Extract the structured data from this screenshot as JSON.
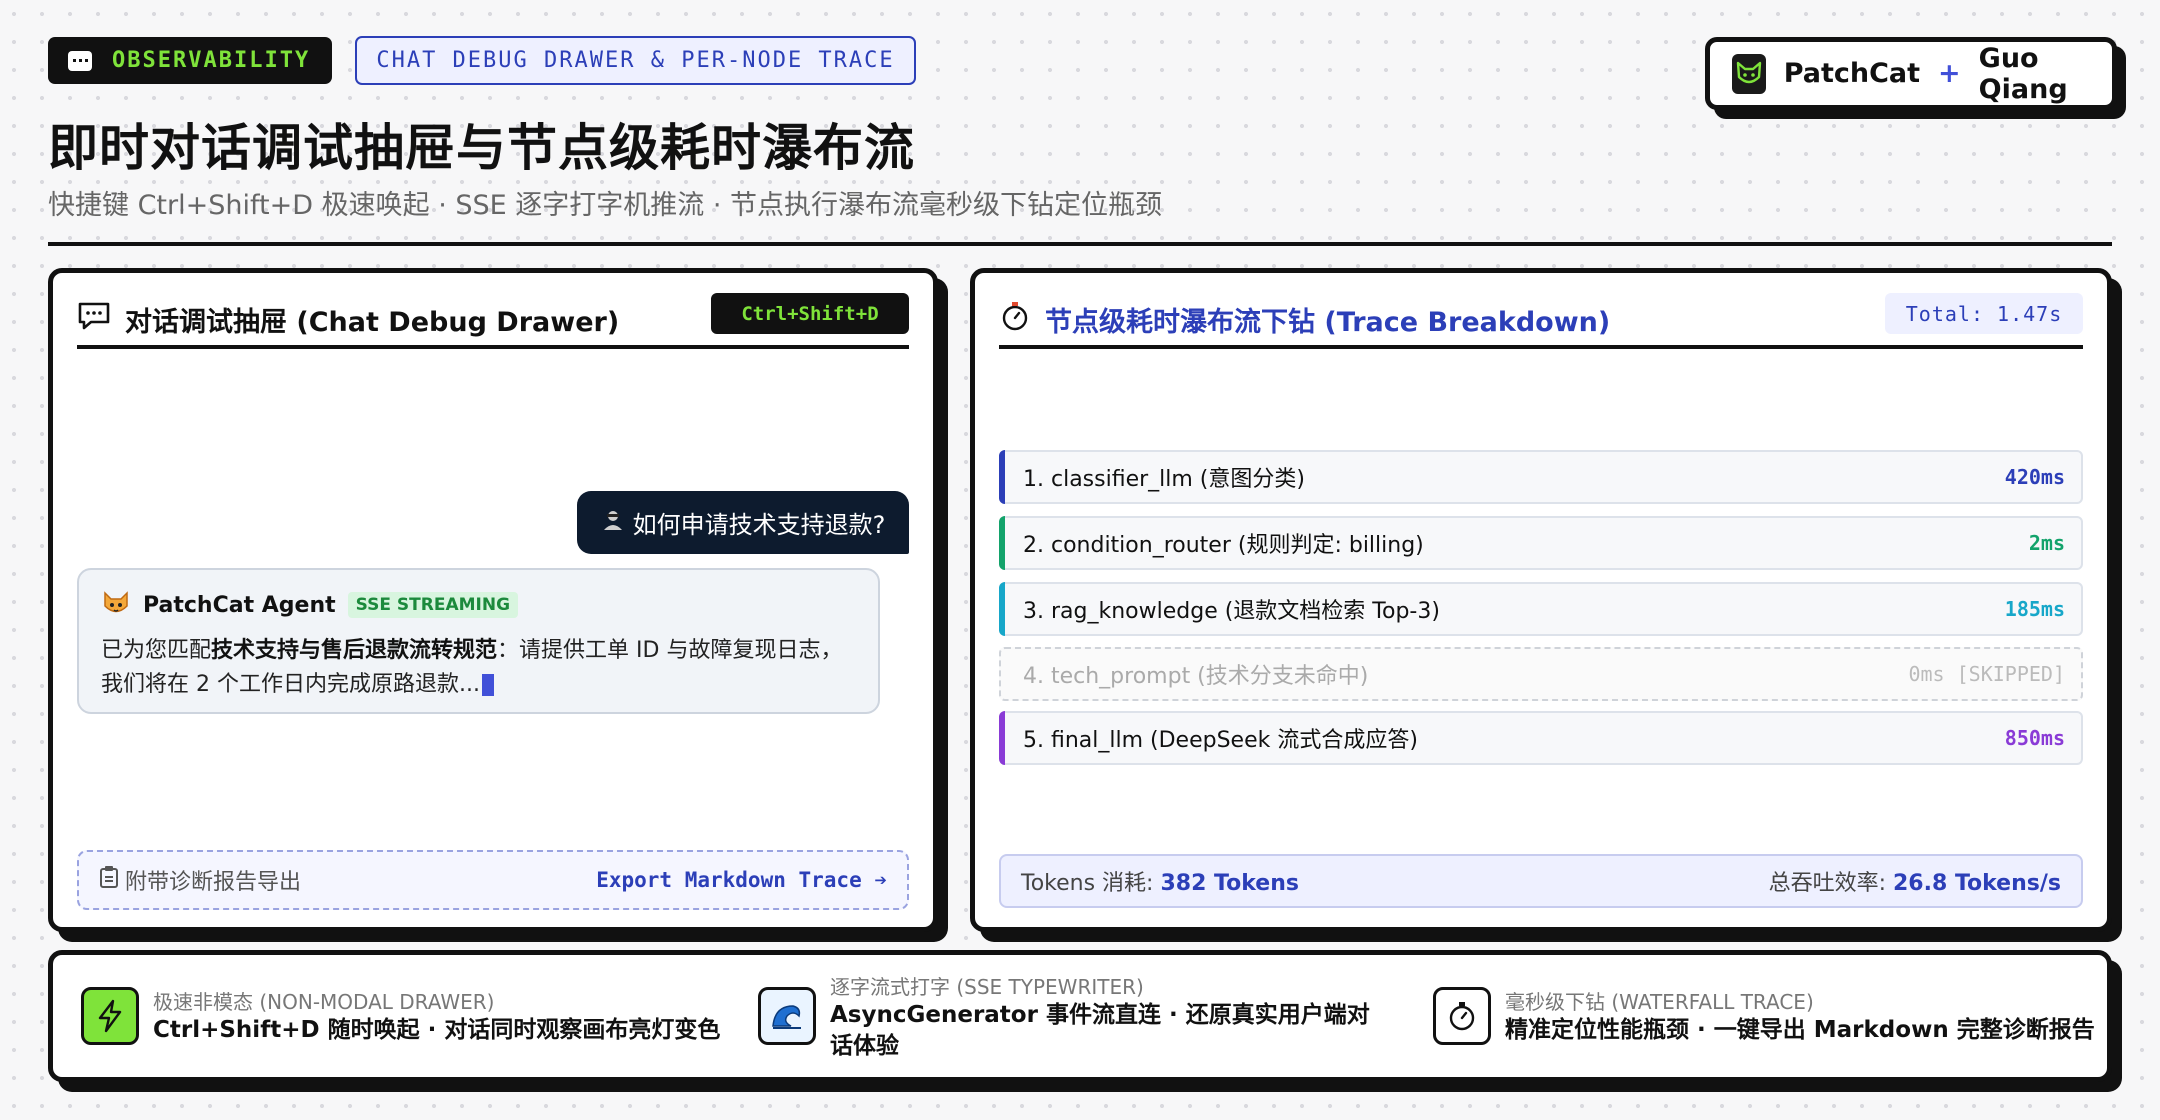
{
  "header": {
    "tag_primary": "OBSERVABILITY",
    "tag_secondary": "CHAT DEBUG DRAWER & PER-NODE TRACE",
    "brand_name": "PatchCat",
    "brand_plus": "+",
    "brand_author": "Guo Qiang",
    "title": "即时对话调试抽屉与节点级耗时瀑布流",
    "subtitle": "快捷键 Ctrl+Shift+D 极速唤起 · SSE 逐字打字机推流 · 节点执行瀑布流毫秒级下钻定位瓶颈"
  },
  "chat_panel": {
    "title": "对话调试抽屉 (Chat Debug Drawer)",
    "shortcut": "Ctrl+Shift+D",
    "user_message": "如何申请技术支持退款?",
    "agent_name": "PatchCat Agent",
    "agent_status": "SSE STREAMING",
    "agent_text_prefix": "已为您匹配",
    "agent_text_bold": "技术支持与售后退款流转规范",
    "agent_text_suffix": "：请提供工单 ID 与故障复现日志，我们将在 2 个工作日内完成原路退款...",
    "export_label": "附带诊断报告导出",
    "export_link": "Export Markdown Trace ➔"
  },
  "trace_panel": {
    "title": "节点级耗时瀑布流下钻 (Trace Breakdown)",
    "total": "Total: 1.47s",
    "nodes": [
      {
        "label": "1. classifier_llm (意图分类)",
        "duration": "420ms",
        "color": "#2c3fb8",
        "skipped": false
      },
      {
        "label": "2. condition_router (规则判定: billing)",
        "duration": "2ms",
        "color": "#13a36b",
        "skipped": false
      },
      {
        "label": "3. rag_knowledge (退款文档检索 Top-3)",
        "duration": "185ms",
        "color": "#17a7c9",
        "skipped": false
      },
      {
        "label": "4. tech_prompt (技术分支未命中)",
        "duration": "0ms [SKIPPED]",
        "color": "#cccccc",
        "skipped": true
      },
      {
        "label": "5. final_llm (DeepSeek 流式合成应答)",
        "duration": "850ms",
        "color": "#8a3bd6",
        "skipped": false
      }
    ],
    "tokens_label": "Tokens 消耗: ",
    "tokens_value": "382 Tokens",
    "throughput_label": "总吞吐效率: ",
    "throughput_value": "26.8 Tokens/s"
  },
  "features": [
    {
      "kicker": "极速非模态 (NON-MODAL DRAWER)",
      "desc": "Ctrl+Shift+D 随时唤起 · 对话同时观察画布亮灯变色",
      "icon": "lightning-icon"
    },
    {
      "kicker": "逐字流式打字 (SSE TYPEWRITER)",
      "desc": "AsyncGenerator 事件流直连 · 还原真实用户端对话体验",
      "icon": "wave-icon"
    },
    {
      "kicker": "毫秒级下钻 (WATERFALL TRACE)",
      "desc": "精准定位性能瓶颈 · 一键导出 Markdown 完整诊断报告",
      "icon": "stopwatch-icon"
    }
  ]
}
